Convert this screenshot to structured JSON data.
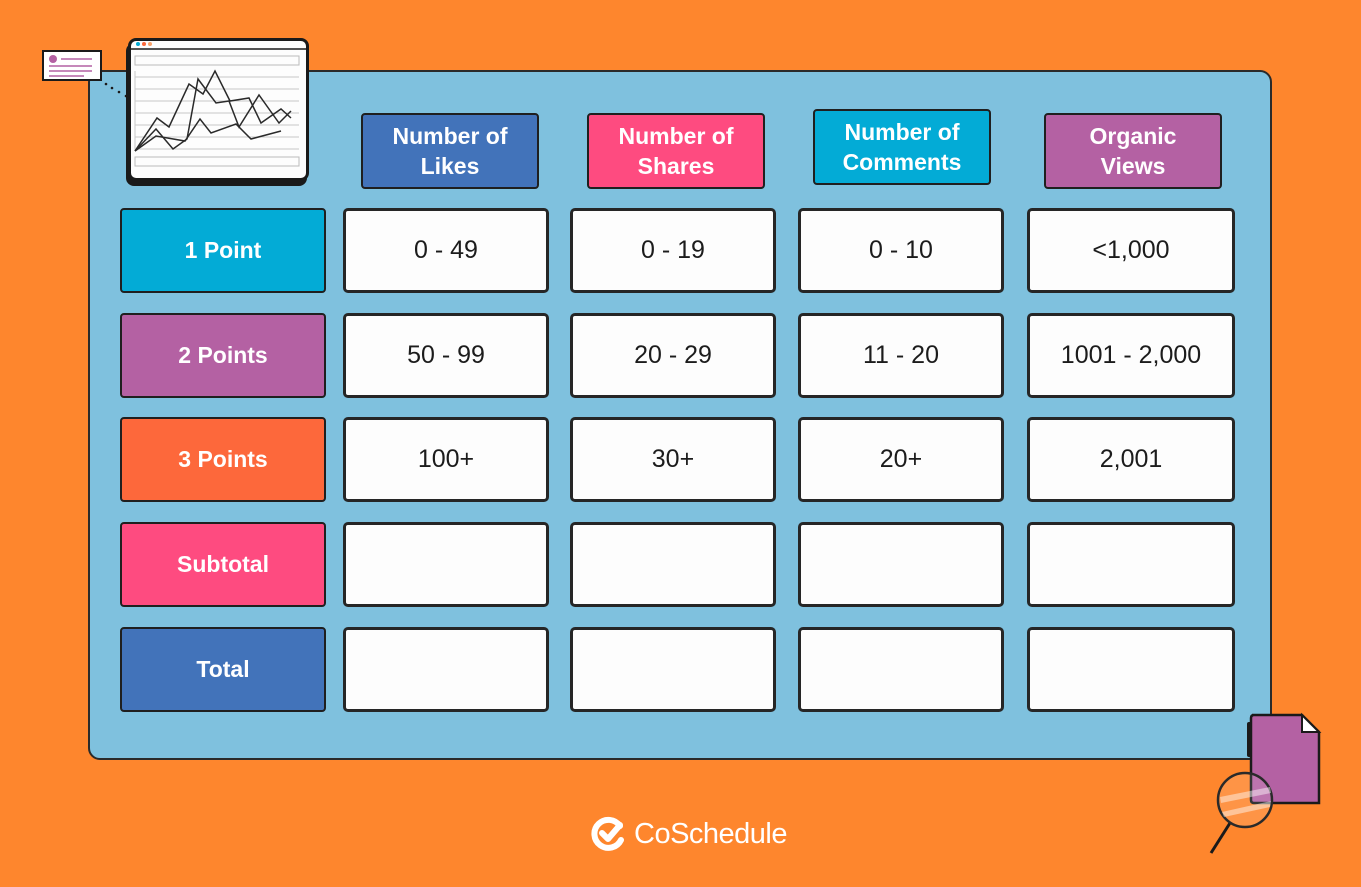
{
  "colors": {
    "background": "#fe862d",
    "board": "#7fc1de",
    "blue": "#4273ba",
    "pink": "#fe4b80",
    "cyan": "#03abd6",
    "purple": "#b461a3",
    "orange_red": "#fd683b"
  },
  "table": {
    "columns": [
      {
        "line1": "Number of",
        "line2": "Likes",
        "color": "#4273ba"
      },
      {
        "line1": "Number of",
        "line2": "Shares",
        "color": "#fe4b80"
      },
      {
        "line1": "Number of",
        "line2": "Comments",
        "color": "#03abd6"
      },
      {
        "line1": "Organic",
        "line2": "Views",
        "color": "#b461a3"
      }
    ],
    "rows": [
      {
        "label": "1 Point",
        "color": "#03abd6",
        "cells": [
          "0 - 49",
          "0 - 19",
          "0 - 10",
          "<1,000"
        ]
      },
      {
        "label": "2 Points",
        "color": "#b461a3",
        "cells": [
          "50 - 99",
          "20 - 29",
          "11 - 20",
          "1001 - 2,000"
        ]
      },
      {
        "label": "3 Points",
        "color": "#fd683b",
        "cells": [
          "100+",
          "30+",
          "20+",
          "2,001"
        ]
      },
      {
        "label": "Subtotal",
        "color": "#fe4b80",
        "cells": [
          "",
          "",
          "",
          ""
        ]
      },
      {
        "label": "Total",
        "color": "#4273ba",
        "cells": [
          "",
          "",
          "",
          ""
        ]
      }
    ]
  },
  "decorations": {
    "browser_window_icon": "line-chart-browser-icon",
    "note_card_icon": "profile-card-icon",
    "document_icon": "document-icon",
    "magnifier_icon": "magnifying-glass-icon"
  },
  "brand": {
    "name": "CoSchedule",
    "icon": "checkmark-logo-icon"
  }
}
